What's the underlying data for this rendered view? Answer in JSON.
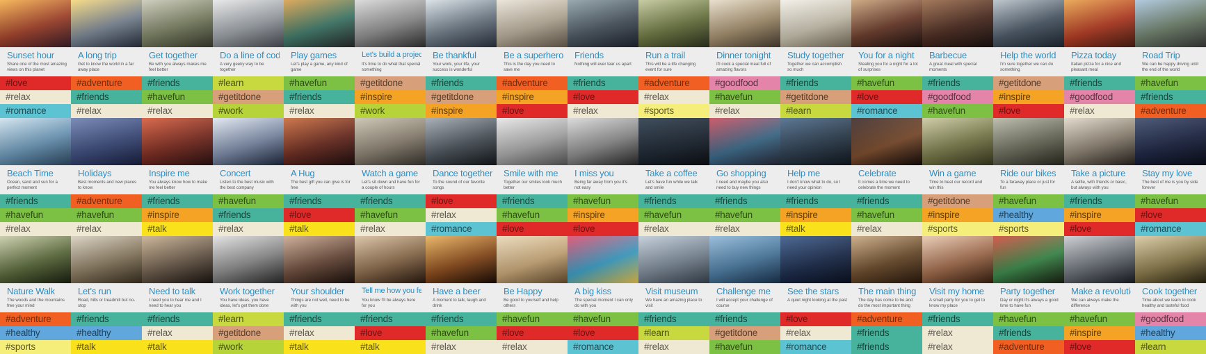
{
  "palette": {
    "love": "#e02a2a",
    "relax": "#efe8d3",
    "romance": "#5cc3d3",
    "adventure": "#f25f22",
    "friends": "#47b39c",
    "learn": "#c8d940",
    "havefun": "#7cc143",
    "getitdone": "#d8a07a",
    "work": "#b7d33a",
    "inspire": "#f4a325",
    "goodfood": "#e484a8",
    "sports": "#f6ee7a",
    "talk": "#f9e21c",
    "healthy": "#5fa7dd"
  },
  "cards": [
    {
      "title": "Sunset hour",
      "desc": "Share one of the most amazing views on this planet",
      "photo": [
        "#f4b04a",
        "#a3412a",
        "#3b1f2c"
      ],
      "tags": [
        "love",
        "relax",
        "romance"
      ]
    },
    {
      "title": "A long trip",
      "desc": "Get to know the world in a far away place",
      "photo": [
        "#f6d77a",
        "#7b8796",
        "#2a3140"
      ],
      "tags": [
        "adventure",
        "friends",
        "relax"
      ]
    },
    {
      "title": "Get together",
      "desc": "Be with you always makes me feel better",
      "photo": [
        "#c9c9b8",
        "#7a8062",
        "#3a3d2e"
      ],
      "tags": [
        "friends",
        "havefun",
        "relax"
      ]
    },
    {
      "title": "Do a line of code",
      "desc": "A very geeky way to be together",
      "photo": [
        "#e6e6e6",
        "#9aa0a6",
        "#4a4f56"
      ],
      "tags": [
        "learn",
        "getitdone",
        "work"
      ]
    },
    {
      "title": "Play games",
      "desc": "Let's play a game, any kind of game",
      "photo": [
        "#d9a04a",
        "#3f7a6a",
        "#2a2a2a"
      ],
      "tags": [
        "havefun",
        "friends",
        "relax"
      ]
    },
    {
      "title": "Let's build a project",
      "desc": "It's time to do what that special something",
      "photo": [
        "#d8d8d8",
        "#8d8d8d",
        "#333333"
      ],
      "tags": [
        "getitdone",
        "inspire",
        "work"
      ]
    },
    {
      "title": "Be thankful",
      "desc": "Your work, your life, your success is wonderful",
      "photo": [
        "#d8e0e6",
        "#6d7a86",
        "#2c3340"
      ],
      "tags": [
        "friends",
        "getitdone",
        "inspire"
      ]
    },
    {
      "title": "Be a superhero",
      "desc": "This is the day you need to save me",
      "photo": [
        "#e8e2d6",
        "#b7ab98",
        "#6a5e50"
      ],
      "tags": [
        "adventure",
        "inspire",
        "love"
      ]
    },
    {
      "title": "Friends",
      "desc": "Nothing will ever tear us apart",
      "photo": [
        "#8da0a6",
        "#4a5560",
        "#1f2430"
      ],
      "tags": [
        "friends",
        "love",
        "relax"
      ]
    },
    {
      "title": "Run a trail",
      "desc": "This will be a life changing event for sure",
      "photo": [
        "#c2c69a",
        "#6b7640",
        "#2e3420"
      ],
      "tags": [
        "adventure",
        "relax",
        "sports"
      ]
    },
    {
      "title": "Dinner tonight",
      "desc": "I'll cook a special meal full of amazing flavors",
      "photo": [
        "#e6dcc8",
        "#a38e6c",
        "#4a3f33"
      ],
      "tags": [
        "goodfood",
        "havefun",
        "relax"
      ]
    },
    {
      "title": "Study together",
      "desc": "Together we can accomplish so much",
      "photo": [
        "#f0eee6",
        "#c9c2b0",
        "#7a705e"
      ],
      "tags": [
        "friends",
        "getitdone",
        "learn"
      ]
    },
    {
      "title": "You for a night",
      "desc": "Stealing you for a night for a lot of surprises",
      "photo": [
        "#c9a27a",
        "#6a3a2a",
        "#1f1412"
      ],
      "tags": [
        "havefun",
        "love",
        "romance"
      ]
    },
    {
      "title": "Barbecue",
      "desc": "A great meal with special moments",
      "photo": [
        "#9a6a4a",
        "#4a2a1f",
        "#1a1210"
      ],
      "tags": [
        "friends",
        "goodfood",
        "havefun"
      ]
    },
    {
      "title": "Help the world",
      "desc": "I'm sure together we can do something",
      "photo": [
        "#b8c0c8",
        "#4a5866",
        "#1f2833"
      ],
      "tags": [
        "getitdone",
        "inspire",
        "love"
      ]
    },
    {
      "title": "Pizza today",
      "desc": "Italian pizza for a nice and pleasant meal",
      "photo": [
        "#e8a24a",
        "#b33a22",
        "#4a1f14"
      ],
      "tags": [
        "friends",
        "goodfood",
        "relax"
      ]
    },
    {
      "title": "Road Trip",
      "desc": "We can be happy driving until the end of the world",
      "photo": [
        "#a9c4dc",
        "#6d7f6a",
        "#3a3a3a"
      ],
      "tags": [
        "havefun",
        "friends",
        "adventure"
      ]
    },
    {
      "title": "Beach Time",
      "desc": "Ocean, sand and sun for a perfect moment",
      "photo": [
        "#cfe2ee",
        "#6a97b8",
        "#2f4a63"
      ],
      "tags": [
        "friends",
        "havefun",
        "relax"
      ]
    },
    {
      "title": "Holidays",
      "desc": "Best moments and new places to know",
      "photo": [
        "#6d80b0",
        "#3a4a7a",
        "#1a2040"
      ],
      "tags": [
        "adventure",
        "havefun",
        "relax"
      ]
    },
    {
      "title": "Inspire me",
      "desc": "You always know how to make me feel better",
      "photo": [
        "#d65a3a",
        "#7a2a1f",
        "#2a1212"
      ],
      "tags": [
        "friends",
        "inspire",
        "talk"
      ]
    },
    {
      "title": "Concert",
      "desc": "Listen to the best music with the best company",
      "photo": [
        "#e0e6f0",
        "#7a8aa6",
        "#1f2a40"
      ],
      "tags": [
        "havefun",
        "friends",
        "relax"
      ]
    },
    {
      "title": "A Hug",
      "desc": "The best gift you can give is for free",
      "photo": [
        "#c96a3a",
        "#6a2a1f",
        "#1f0f0f"
      ],
      "tags": [
        "friends",
        "love",
        "talk"
      ]
    },
    {
      "title": "Watch a game",
      "desc": "Let's sit down and have fun for a couple of hours",
      "photo": [
        "#c9c2b0",
        "#8a8070",
        "#3a3530"
      ],
      "tags": [
        "friends",
        "havefun",
        "relax"
      ]
    },
    {
      "title": "Dance together",
      "desc": "To the sound of our favorite songs",
      "photo": [
        "#a0a8b0",
        "#4a525a",
        "#14181c"
      ],
      "tags": [
        "love",
        "relax",
        "romance"
      ]
    },
    {
      "title": "Smile with me",
      "desc": "Together our smiles look much better",
      "photo": [
        "#e6e6e6",
        "#a8a8a8",
        "#5a5a5a"
      ],
      "tags": [
        "friends",
        "havefun",
        "love"
      ]
    },
    {
      "title": "I miss you",
      "desc": "Being far away from you it's not easy",
      "photo": [
        "#d8d8d8",
        "#8a8a8a",
        "#2a2a2a"
      ],
      "tags": [
        "havefun",
        "inspire",
        "love"
      ]
    },
    {
      "title": "Take a coffee",
      "desc": "Let's have fun while we talk and smile",
      "photo": [
        "#2a3a4a",
        "#1a2430",
        "#0c1014"
      ],
      "tags": [
        "friends",
        "havefun",
        "relax"
      ]
    },
    {
      "title": "Go shopping",
      "desc": "I need and maybe you also need to buy new things",
      "photo": [
        "#c84a5a",
        "#3a6a8a",
        "#2a2a3a"
      ],
      "tags": [
        "friends",
        "havefun",
        "relax"
      ]
    },
    {
      "title": "Help me",
      "desc": "I don't know what to do, so I need your opinion",
      "photo": [
        "#4a6a8a",
        "#2a3a4a",
        "#101820"
      ],
      "tags": [
        "friends",
        "inspire",
        "talk"
      ]
    },
    {
      "title": "Celebrate",
      "desc": "It comes a time we need to celebrate the moment",
      "photo": [
        "#3a2a2a",
        "#7a4a2a",
        "#140c0a"
      ],
      "tags": [
        "friends",
        "havefun",
        "relax"
      ]
    },
    {
      "title": "Win a game",
      "desc": "Time to beat our record and win this",
      "photo": [
        "#c9c8a0",
        "#7a7a4a",
        "#3a3a20"
      ],
      "tags": [
        "getitdone",
        "inspire",
        "sports"
      ]
    },
    {
      "title": "Ride our bikes",
      "desc": "To a faraway place or just for fun",
      "photo": [
        "#b8b8a8",
        "#6a6a5a",
        "#2a2a20"
      ],
      "tags": [
        "havefun",
        "healthy",
        "sports"
      ]
    },
    {
      "title": "Take a picture",
      "desc": "A selfie, with friends or basic, but always with you",
      "photo": [
        "#e0d8c8",
        "#8a8070",
        "#2a2420"
      ],
      "tags": [
        "friends",
        "inspire",
        "love"
      ]
    },
    {
      "title": "Stay my love",
      "desc": "The best of me is you by side forever",
      "photo": [
        "#3a4a6a",
        "#1a2240",
        "#0a0e1a"
      ],
      "tags": [
        "havefun",
        "love",
        "romance"
      ]
    },
    {
      "title": "Nature Walk",
      "desc": "The woods and the mountains free your mind",
      "photo": [
        "#c8cca8",
        "#5a6a3a",
        "#1a2010"
      ],
      "tags": [
        "adventure",
        "healthy",
        "sports"
      ]
    },
    {
      "title": "Let's run",
      "desc": "Road, hills or treadmill but no-stop",
      "photo": [
        "#d8d0c0",
        "#8a7a60",
        "#3a3020"
      ],
      "tags": [
        "friends",
        "healthy",
        "talk"
      ]
    },
    {
      "title": "Need to talk",
      "desc": "I need you to hear me and I need to hear you",
      "photo": [
        "#c9b090",
        "#6a5a4a",
        "#1a1410"
      ],
      "tags": [
        "friends",
        "relax",
        "talk"
      ]
    },
    {
      "title": "Work together",
      "desc": "You have ideas, you have ideas, let's get them done",
      "photo": [
        "#e0e0e0",
        "#8a8a8a",
        "#2a2a2a"
      ],
      "tags": [
        "learn",
        "getitdone",
        "work"
      ]
    },
    {
      "title": "Your shoulder",
      "desc": "Things are not well, need to be with you",
      "photo": [
        "#c9a890",
        "#6a4a3a",
        "#1a100c"
      ],
      "tags": [
        "friends",
        "relax",
        "talk"
      ]
    },
    {
      "title": "Tell me how you feel",
      "desc": "You know I'll be always here for you",
      "photo": [
        "#d8c0a0",
        "#8a6a4a",
        "#2a1a10"
      ],
      "tags": [
        "friends",
        "love",
        "talk"
      ]
    },
    {
      "title": "Have a beer",
      "desc": "A moment to talk, laugh and drink",
      "photo": [
        "#e8b05a",
        "#8a4a1a",
        "#1a0c06"
      ],
      "tags": [
        "friends",
        "havefun",
        "relax"
      ]
    },
    {
      "title": "Be Happy",
      "desc": "Be good to yourself and help others",
      "photo": [
        "#e8d8b8",
        "#c9a878",
        "#6a5030"
      ],
      "tags": [
        "havefun",
        "love",
        "relax"
      ]
    },
    {
      "title": "A big kiss",
      "desc": "The special moment I can only do with you",
      "photo": [
        "#e04a6a",
        "#3aa0c8",
        "#f0c84a"
      ],
      "tags": [
        "havefun",
        "love",
        "romance"
      ]
    },
    {
      "title": "Visit museum",
      "desc": "We have an amazing place to visit",
      "photo": [
        "#c0ccd8",
        "#7a8896",
        "#3a4450"
      ],
      "tags": [
        "friends",
        "learn",
        "relax"
      ]
    },
    {
      "title": "Challenge me",
      "desc": "I will accept your challenge of course",
      "photo": [
        "#90b8d8",
        "#4a7aa0",
        "#1a3450"
      ],
      "tags": [
        "friends",
        "getitdone",
        "havefun"
      ]
    },
    {
      "title": "See the stars",
      "desc": "A quiet night looking at the past",
      "photo": [
        "#3a5a8a",
        "#1a2a4a",
        "#0a1020"
      ],
      "tags": [
        "love",
        "relax",
        "romance"
      ]
    },
    {
      "title": "The main thing",
      "desc": "The day has come to be and do the most important thing",
      "photo": [
        "#c8a880",
        "#6a4a2a",
        "#2a1a0c"
      ],
      "tags": [
        "adventure",
        "friends",
        "friends"
      ]
    },
    {
      "title": "Visit my home",
      "desc": "A small party for you to get to know my place",
      "photo": [
        "#e8c8b0",
        "#a06a4a",
        "#3a2010"
      ],
      "tags": [
        "friends",
        "relax",
        "relax"
      ]
    },
    {
      "title": "Party together",
      "desc": "Day or night it's always a good time to have fun",
      "photo": [
        "#d04a3a",
        "#3a8a4a",
        "#1a2010"
      ],
      "tags": [
        "havefun",
        "friends",
        "adventure"
      ]
    },
    {
      "title": "Make a revolution",
      "desc": "We can always make the difference",
      "photo": [
        "#c8ccd0",
        "#6a7078",
        "#1a1e24"
      ],
      "tags": [
        "havefun",
        "inspire",
        "love"
      ]
    },
    {
      "title": "Cook together",
      "desc": "Time about we learn to cook healthy and tasteful food",
      "photo": [
        "#d8c8a0",
        "#8a7a4a",
        "#2a2410"
      ],
      "tags": [
        "goodfood",
        "healthy",
        "learn"
      ]
    }
  ]
}
